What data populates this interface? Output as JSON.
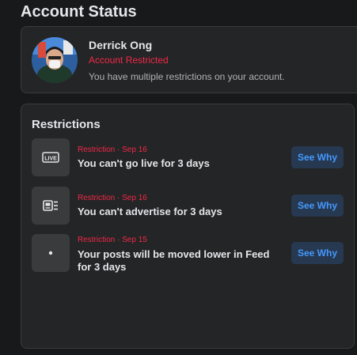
{
  "page": {
    "title": "Account Status"
  },
  "profile": {
    "name": "Derrick Ong",
    "status": "Account Restricted",
    "description": "You have multiple restrictions on your account."
  },
  "restrictions": {
    "title": "Restrictions",
    "items": [
      {
        "icon": "live-icon",
        "icon_label": "LIVE",
        "meta": "Restriction · Sep 16",
        "text": "You can't go live for 3 days",
        "button": "See Why"
      },
      {
        "icon": "advertise-icon",
        "meta": "Restriction · Sep 16",
        "text": "You can't advertise for 3 days",
        "button": "See Why"
      },
      {
        "icon": "dot-icon",
        "meta": "Restriction · Sep 15",
        "text": "Your posts will be moved lower in Feed for 3 days",
        "button": "See Why"
      }
    ]
  },
  "colors": {
    "background": "#18191a",
    "card": "#242526",
    "restriction_red": "#f02849",
    "button_bg": "#263951",
    "button_text": "#4599ff"
  }
}
